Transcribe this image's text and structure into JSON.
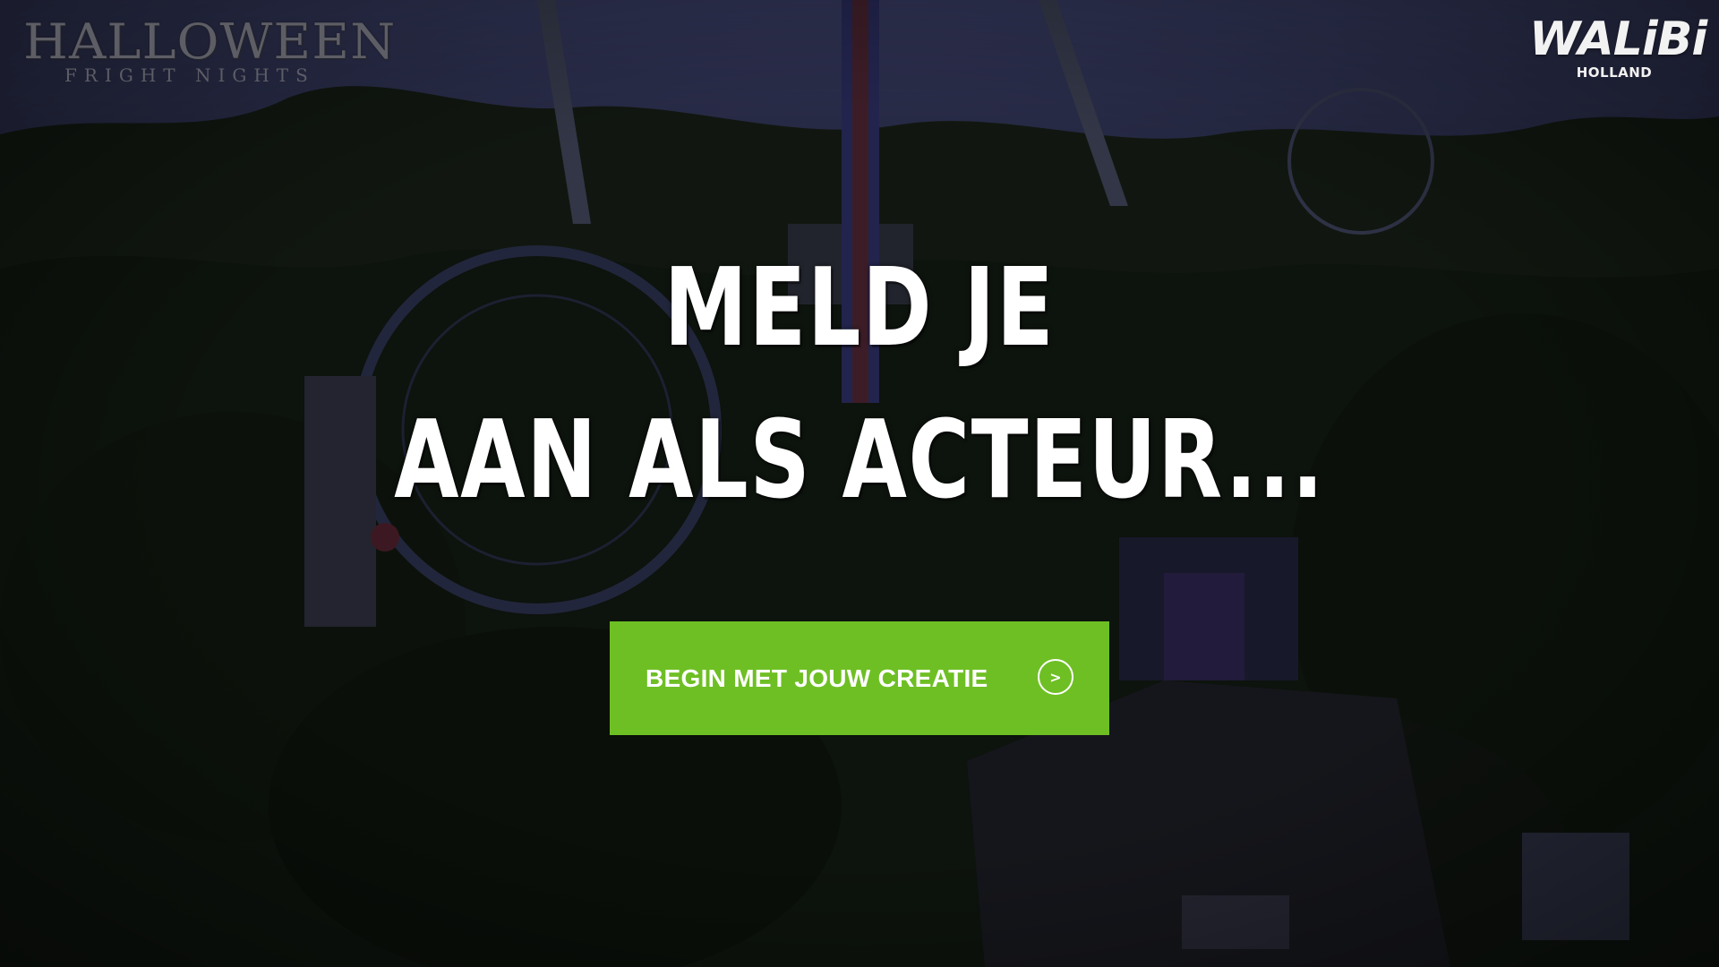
{
  "header": {
    "halloween_logo": {
      "title": "HALLOWEEN",
      "subtitle": "FRIGHT NIGHTS"
    },
    "walibi_logo": {
      "brand": "WALiBi",
      "region": "HOLLAND"
    }
  },
  "hero": {
    "headline_line1": "Meld je",
    "headline_line2": "aan als acteur..."
  },
  "cta": {
    "label": "BEGIN MET JOUW CREATIE",
    "arrow": ">",
    "color": "#6ebf24"
  },
  "icons": {
    "cta_arrow": "circle-chevron-right-icon"
  }
}
